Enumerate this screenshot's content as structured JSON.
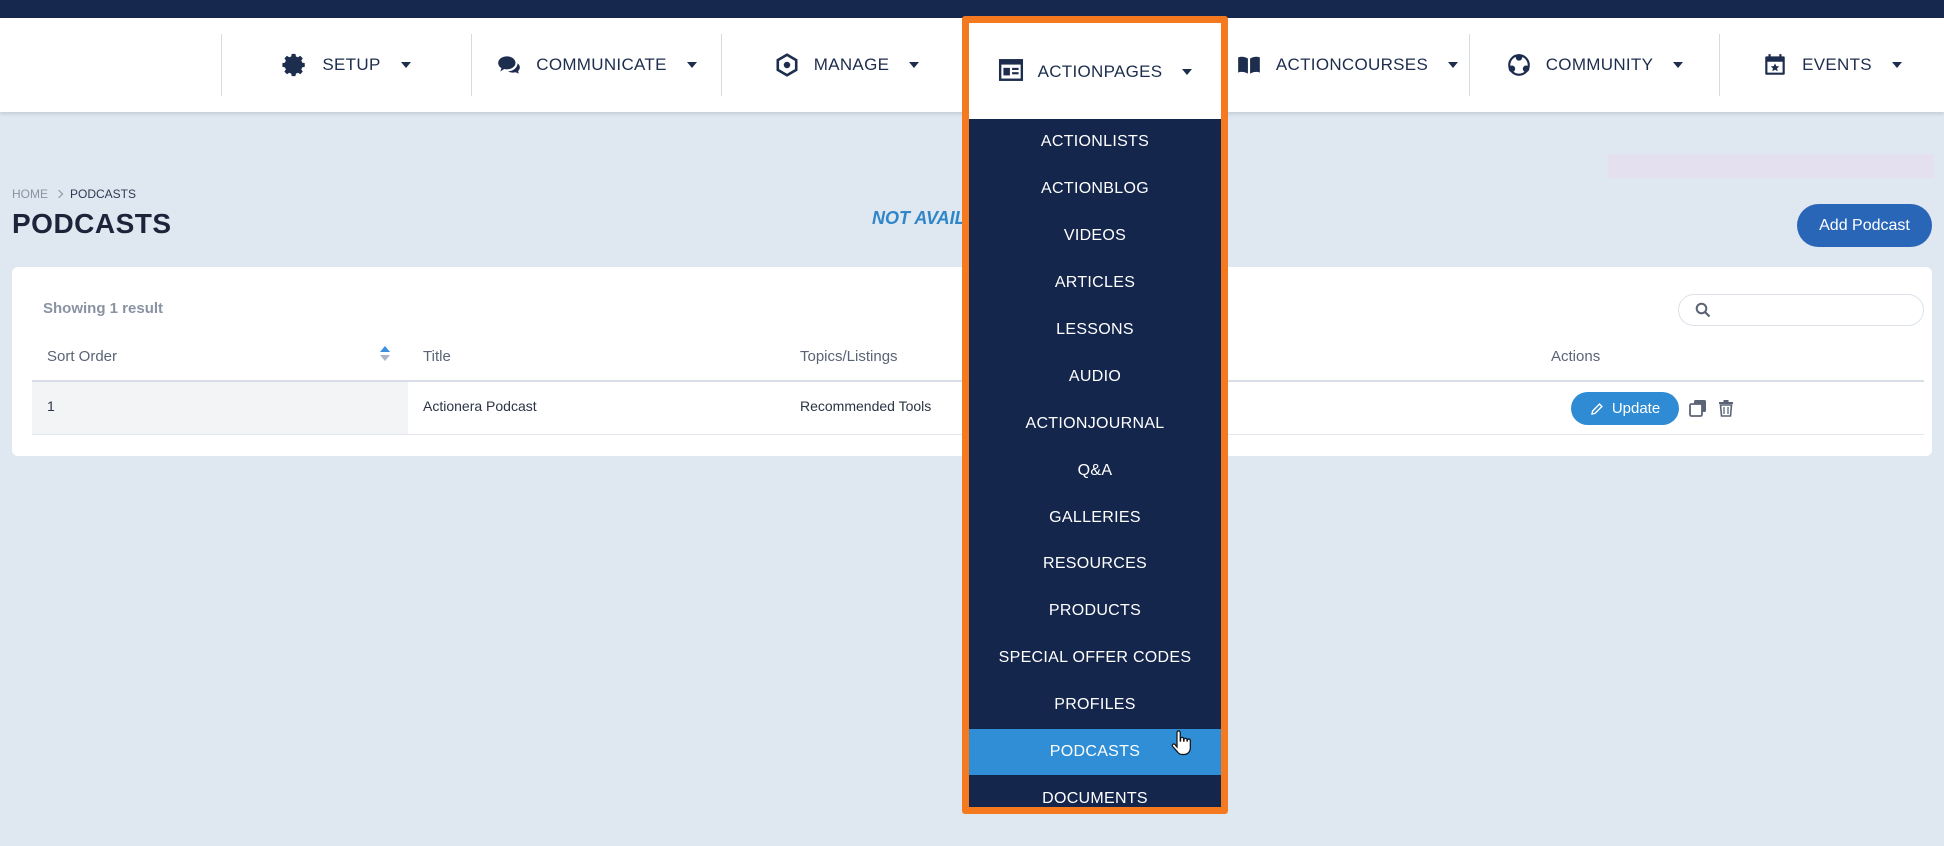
{
  "nav": {
    "items": [
      {
        "label": "SETUP",
        "icon": "gear-icon"
      },
      {
        "label": "COMMUNICATE",
        "icon": "chat-icon"
      },
      {
        "label": "MANAGE",
        "icon": "manage-icon"
      },
      {
        "label": "ACTIONPAGES",
        "icon": "pages-icon"
      },
      {
        "label": "ACTIONCOURSES",
        "icon": "book-icon"
      },
      {
        "label": "COMMUNITY",
        "icon": "community-icon"
      },
      {
        "label": "EVENTS",
        "icon": "calendar-icon"
      }
    ]
  },
  "dropdown": {
    "items": [
      "ACTIONLISTS",
      "ACTIONBLOG",
      "VIDEOS",
      "ARTICLES",
      "LESSONS",
      "AUDIO",
      "ACTIONJOURNAL",
      "Q&A",
      "GALLERIES",
      "RESOURCES",
      "PRODUCTS",
      "SPECIAL OFFER CODES",
      "PROFILES",
      "PODCASTS",
      "DOCUMENTS"
    ],
    "active": "PODCASTS",
    "highlight_color": "#f57a1f"
  },
  "breadcrumb": {
    "home": "HOME",
    "current": "PODCASTS"
  },
  "page": {
    "title": "PODCASTS",
    "notice": "NOT AVAIL",
    "add_button": "Add Podcast"
  },
  "table": {
    "showing": "Showing 1 result",
    "search_placeholder": "",
    "columns": {
      "sort_order": "Sort Order",
      "title": "Title",
      "topics": "Topics/Listings",
      "actions": "Actions"
    },
    "rows": [
      {
        "sort_order": "1",
        "title": "Actionera Podcast",
        "topics": "Recommended Tools",
        "update_label": "Update"
      }
    ]
  },
  "colors": {
    "navy": "#15264d",
    "accent_blue": "#2f8ed6",
    "button_blue": "#2966b8",
    "background": "#dfe7f0"
  }
}
